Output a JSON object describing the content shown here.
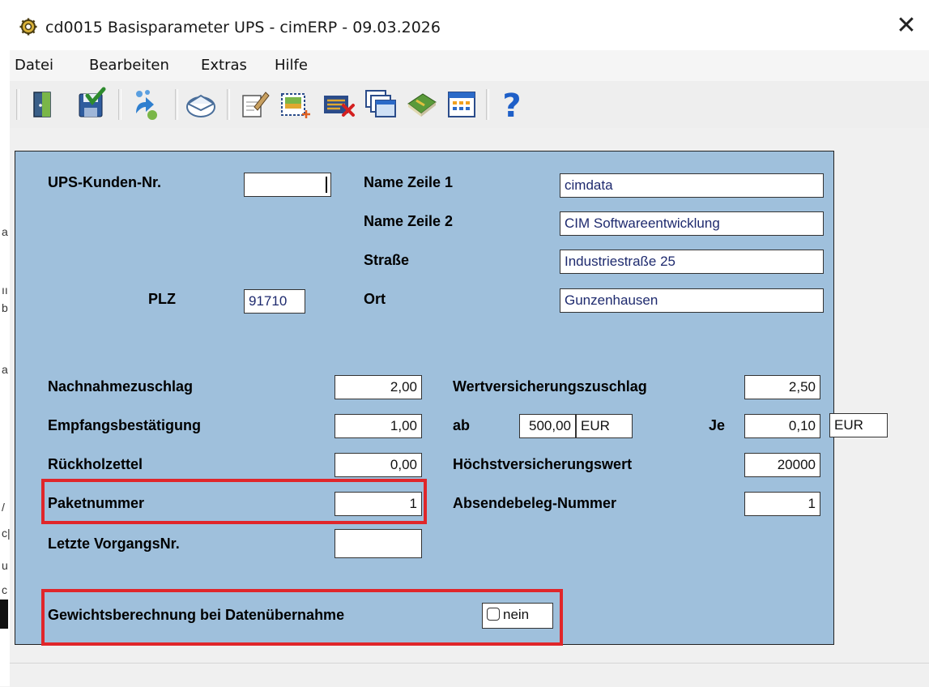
{
  "window": {
    "title": "cd0015 Basisparameter UPS - cimERP - 09.03.2026",
    "close_glyph": "✕"
  },
  "menu": [
    "Datei",
    "Bearbeiten",
    "Extras",
    "Hilfe"
  ],
  "toolbar_icons": [
    "exit-door-icon",
    "save-icon",
    "refresh-icon",
    "mail-icon",
    "edit-icon",
    "new-record-icon",
    "delete-record-icon",
    "windows-icon",
    "book-icon",
    "calendar-icon",
    "help-icon"
  ],
  "form": {
    "kunden_nr": {
      "label": "UPS-Kunden-Nr.",
      "value": ""
    },
    "name1": {
      "label": "Name Zeile 1",
      "value": "cimdata"
    },
    "name2": {
      "label": "Name Zeile 2",
      "value": "CIM Softwareentwicklung"
    },
    "strasse": {
      "label": "Straße",
      "value": "Industriestraße 25"
    },
    "plz": {
      "label": "PLZ",
      "value": "91710"
    },
    "ort": {
      "label": "Ort",
      "value": "Gunzenhausen"
    },
    "nachnahme": {
      "label": "Nachnahmezuschlag",
      "value": "2,00"
    },
    "empfang": {
      "label": "Empfangsbestätigung",
      "value": "1,00"
    },
    "rueckhol": {
      "label": "Rückholzettel",
      "value": "0,00"
    },
    "paket": {
      "label": "Paketnummer",
      "value": "1"
    },
    "vorgang": {
      "label": "Letzte VorgangsNr.",
      "value": ""
    },
    "wertvers": {
      "label": "Wertversicherungszuschlag",
      "value": "2,50"
    },
    "ab": {
      "label": "ab",
      "value": "500,00",
      "currency": "EUR"
    },
    "je": {
      "label": "Je",
      "value": "0,10",
      "currency": "EUR"
    },
    "hoechst": {
      "label": "Höchstversicherungswert",
      "value": "20000"
    },
    "absende": {
      "label": "Absendebeleg-Nummer",
      "value": "1"
    },
    "gewicht": {
      "label": "Gewichtsberechnung bei Datenübernahme",
      "value": "nein",
      "checked": false
    }
  },
  "colors": {
    "panel": "#9fc0dc",
    "highlight": "#e0262a"
  }
}
